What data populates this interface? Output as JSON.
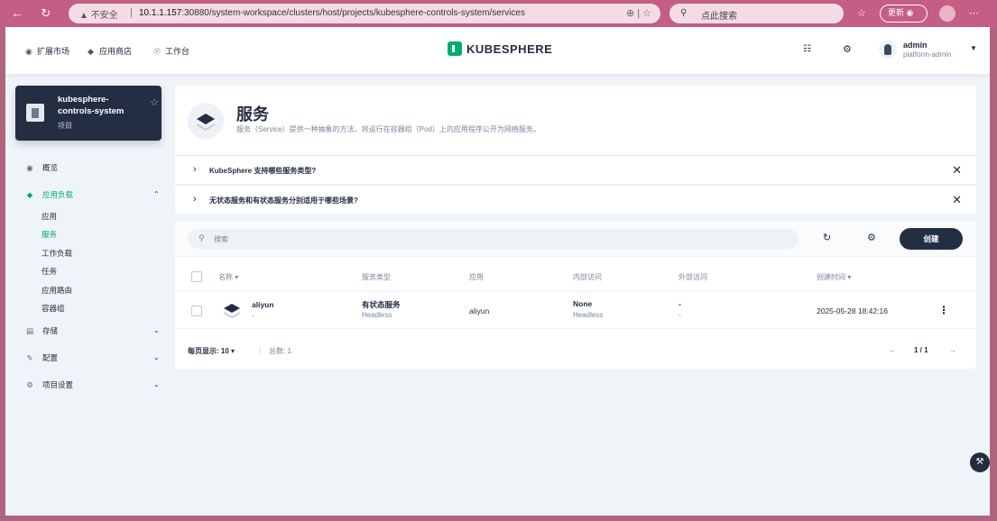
{
  "browser": {
    "back_icon": "arrow-left-icon",
    "reload_icon": "reload-icon",
    "security_label": "不安全",
    "url_host": "10.1.1.157",
    "url_rest": ":30880/system-workspace/clusters/host/projects/kubesphere-controls-system/services",
    "search_placeholder": "点此搜索",
    "update_label": "更新"
  },
  "topnav": {
    "items": [
      {
        "label": "扩展市场",
        "icon": "extension-icon"
      },
      {
        "label": "应用商店",
        "icon": "app-store-icon"
      },
      {
        "label": "工作台",
        "icon": "workbench-icon"
      }
    ],
    "logo_text": "KUBESPHERE",
    "user_name": "admin",
    "user_role": "platform-admin"
  },
  "project": {
    "name": "kubesphere-controls-system",
    "type": "项目"
  },
  "sidebar": {
    "items": [
      {
        "label": "概览",
        "icon": "overview-icon"
      },
      {
        "label": "应用负载",
        "icon": "app-workload-icon"
      },
      {
        "label": "存储",
        "icon": "storage-icon"
      },
      {
        "label": "配置",
        "icon": "config-icon"
      },
      {
        "label": "项目设置",
        "icon": "settings-icon"
      }
    ],
    "subitems": [
      "应用",
      "服务",
      "工作负载",
      "任务",
      "应用路由",
      "容器组"
    ]
  },
  "header": {
    "title": "服务",
    "description": "服务（Service）提供一种抽象的方法，将运行在容器组（Pod）上的应用程序公开为网络服务。"
  },
  "tips": [
    "KubeSphere 支持哪些服务类型?",
    "无状态服务和有状态服务分别适用于哪些场景?"
  ],
  "toolbar": {
    "search_placeholder": "搜索",
    "create_label": "创建"
  },
  "table": {
    "columns": [
      "名称",
      "服务类型",
      "应用",
      "内部访问",
      "外部访问",
      "创建时间"
    ],
    "rows": [
      {
        "name": "aliyun",
        "name_sub": "-",
        "type": "有状态服务",
        "type_sub": "Headless",
        "app": "aliyun",
        "internal": "None",
        "internal_sub": "Headless",
        "external": "-",
        "external_sub": "-",
        "created": "2025-05-28 18:42:16"
      }
    ]
  },
  "pagination": {
    "per_page_label": "每页显示: 10",
    "total_label": "总数: 1",
    "page_label": "1 / 1"
  },
  "colors": {
    "accent": "#00aa72",
    "dark": "#242e42",
    "browser_bar": "#c45e84"
  }
}
